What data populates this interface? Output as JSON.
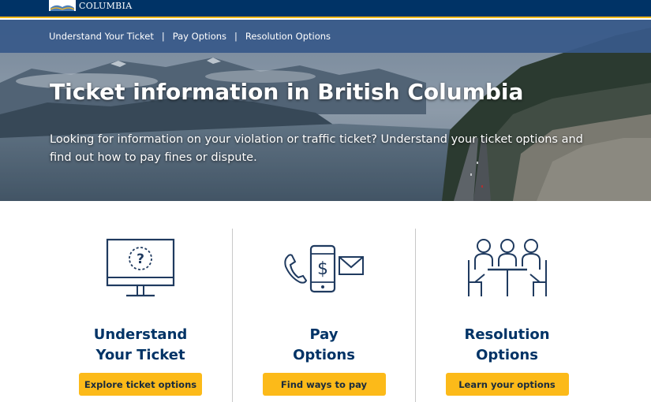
{
  "header": {
    "logo_text": "COLUMBIA",
    "background_color": "#003366",
    "accent_color": "#fcba19"
  },
  "nav": {
    "items": [
      {
        "label": "Understand Your Ticket"
      },
      {
        "label": "Pay Options"
      },
      {
        "label": "Resolution Options"
      }
    ],
    "separator": "|"
  },
  "hero": {
    "title": "Ticket information in British Columbia",
    "description": "Looking for information on your violation or traffic ticket? Understand your ticket options and find out how to pay fines or dispute."
  },
  "cards": [
    {
      "icon": "monitor-question-icon",
      "title_line1": "Understand",
      "title_line2": "Your Ticket",
      "button_label": "Explore ticket options"
    },
    {
      "icon": "phone-payment-envelope-icon",
      "title_line1": "Pay",
      "title_line2": "Options",
      "button_label": "Find ways to pay"
    },
    {
      "icon": "meeting-table-icon",
      "title_line1": "Resolution",
      "title_line2": "Options",
      "button_label": "Learn your options"
    }
  ],
  "colors": {
    "heading": "#003366",
    "button": "#fcba19",
    "nav_bg": "#38598a"
  }
}
